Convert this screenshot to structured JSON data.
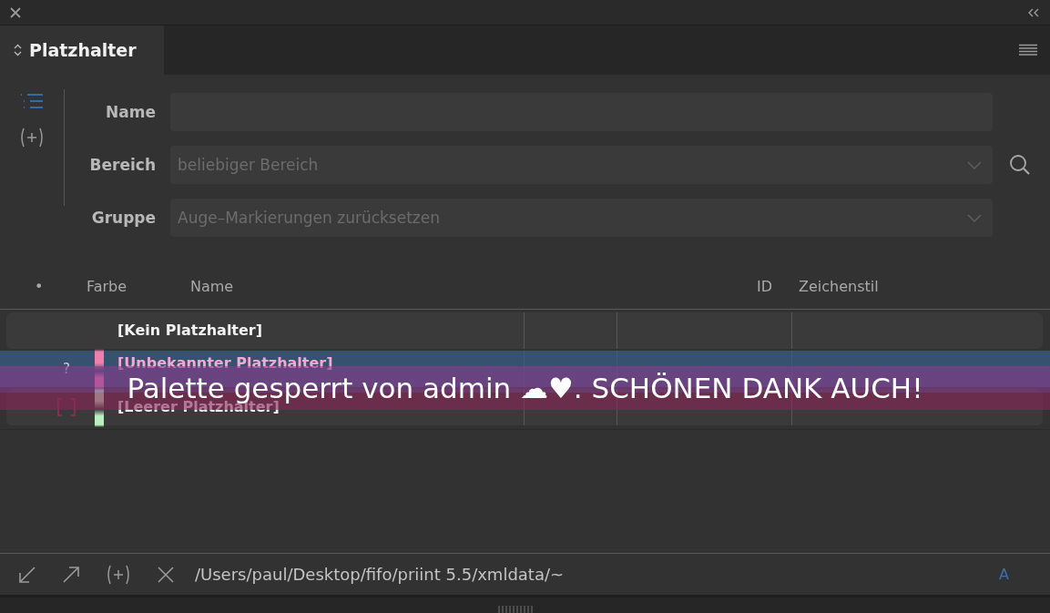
{
  "panel": {
    "title": "Platzhalter"
  },
  "sidebar": [
    {
      "kind": "list",
      "selected": true
    },
    {
      "kind": "add",
      "selected": false
    }
  ],
  "form": [
    {
      "label": "Name",
      "kind": "text"
    },
    {
      "label": "Bereich",
      "kind": "select",
      "value": "beliebiger Bereich"
    },
    {
      "label": "Gruppe",
      "kind": "select",
      "value": "Auge–Markierungen zurücksetzen"
    }
  ],
  "table": {
    "columns": [
      "•",
      "Farbe",
      "Name",
      "ID",
      "Zeichenstil"
    ],
    "rows": [
      {
        "kind": "none",
        "name": "[Kein Platzhalter]",
        "selected": false
      },
      {
        "kind": "unknown",
        "marker": "?",
        "name": "[Unbekannter Platzhalter]",
        "color": "#f07fb0",
        "selected": true
      },
      {
        "kind": "empty",
        "name": "[Leerer Platzhalter]",
        "color": "#b8f0c0",
        "selected": false
      }
    ]
  },
  "banner": {
    "text": "Palette gesperrt von admin ☁♥. SCHÖNEN DANK AUCH!"
  },
  "footer": {
    "path": "/Users/paul/Desktop/fifo/priint 5.5/xmldata/~",
    "indicator": "A"
  }
}
